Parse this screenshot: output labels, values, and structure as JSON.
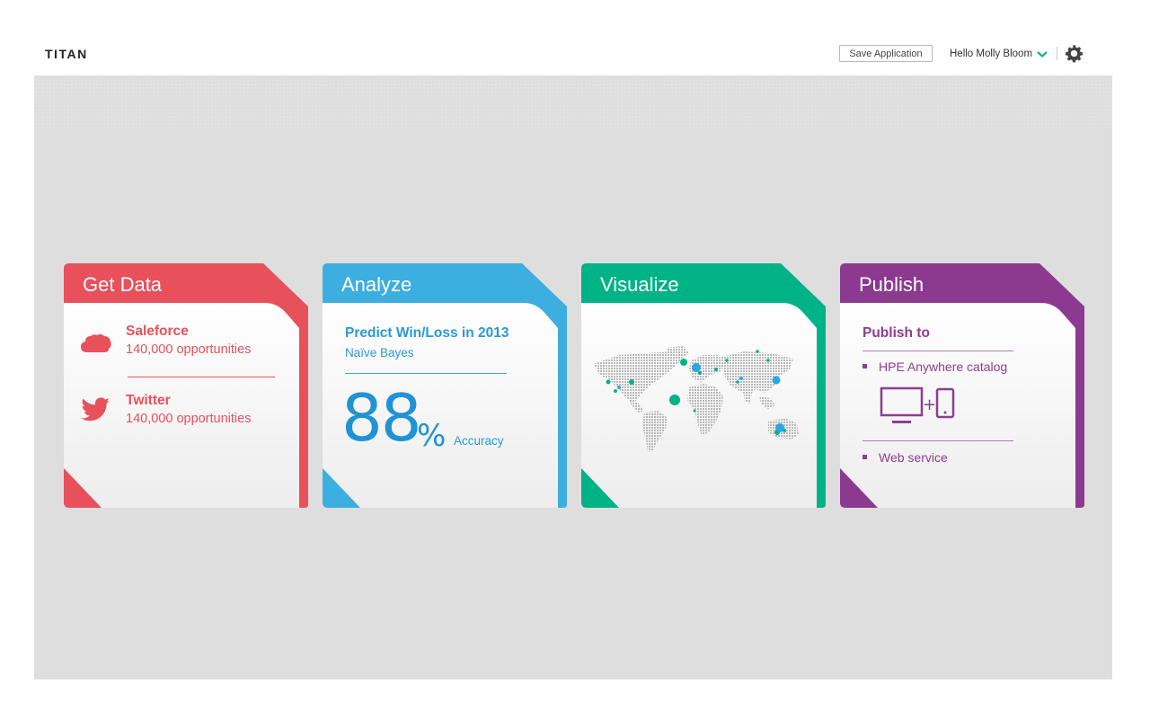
{
  "header": {
    "app_title": "TITAN",
    "save_label": "Save Application",
    "greeting": "Hello Molly Bloom",
    "user_menu_icon": "chevron-down-icon",
    "settings_icon": "gear-icon",
    "accent_color": "#1ab17f"
  },
  "cards": {
    "get_data": {
      "title": "Get Data",
      "color": "#e8505b",
      "sources": [
        {
          "name": "Saleforce",
          "subtitle": "140,000 opportunities",
          "icon": "salesforce-cloud-icon"
        },
        {
          "name": "Twitter",
          "subtitle": "140,000 opportunities",
          "icon": "twitter-bird-icon"
        }
      ]
    },
    "analyze": {
      "title": "Analyze",
      "color": "#3daee0",
      "model_title": "Predict Win/Loss in 2013",
      "algorithm": "Naïve Bayes",
      "accuracy_value": "88",
      "accuracy_unit": "%",
      "accuracy_label": "Accuracy"
    },
    "visualize": {
      "title": "Visualize",
      "color": "#00b386",
      "graphic": "world-map-icon"
    },
    "publish": {
      "title": "Publish",
      "color": "#8b3a90",
      "heading": "Publish to",
      "targets": [
        "HPE Anywhere catalog",
        "Web service"
      ],
      "graphic": "desktop-plus-tablet-icon",
      "plus": "+"
    }
  }
}
